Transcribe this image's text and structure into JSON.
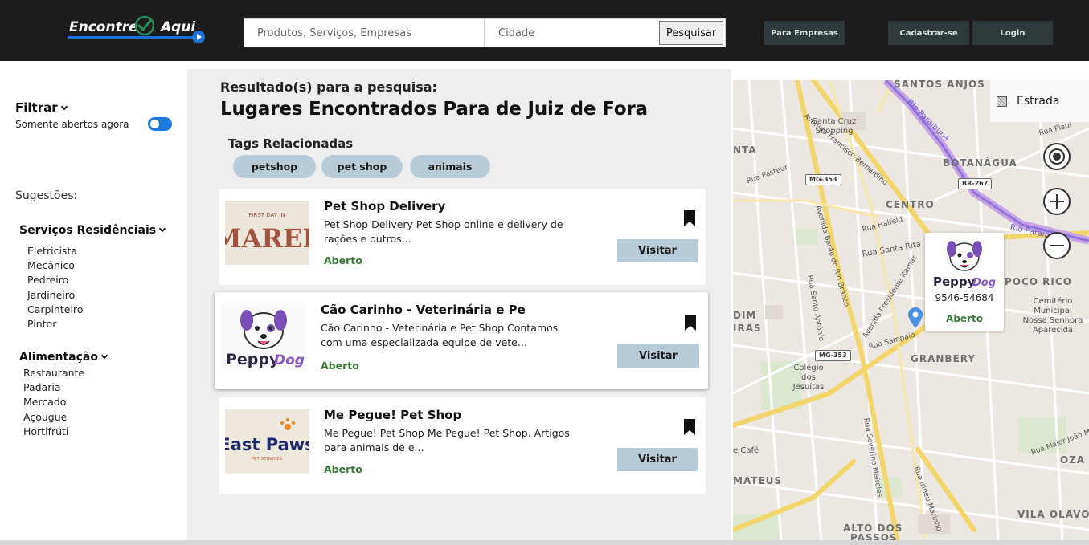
{
  "header": {
    "logo_part1": "Encontre",
    "logo_part2": "Aqui",
    "search_placeholder": "Produtos, Serviços, Empresas",
    "city_placeholder": "Cidade",
    "search_button": "Pesquisar",
    "for_business": "Para Empresas",
    "signup": "Cadastrar-se",
    "login": "Login"
  },
  "sidebar": {
    "filter_title": "Filtrar",
    "open_now_label": "Somente abertos agora",
    "open_now_enabled": true,
    "suggestions_title": "Sugestões:",
    "categories": [
      {
        "title": "Serviços Residênciais",
        "items": [
          "Eletricista",
          "Mecânico",
          "Pedreiro",
          "Jardineiro",
          "Carpinteiro",
          "Pintor"
        ]
      },
      {
        "title": "Alimentação",
        "items": [
          "Restaurante",
          "Padaria",
          "Mercado",
          "Açougue",
          "Hortifrúti"
        ]
      }
    ]
  },
  "results": {
    "subtitle": "Resultado(s) para a pesquisa:",
    "title": "Lugares Encontrados Para de Juiz de Fora",
    "tags_title": "Tags Relacionadas",
    "tags": [
      "petshop",
      "pet shop",
      "animais"
    ],
    "visit_label": "Visitar",
    "cards": [
      {
        "name": "Pet Shop Delivery",
        "description": "Pet Shop Delivery Pet Shop online e delivery de rações e outros...",
        "status": "Aberto",
        "logo_text_small": "FIRST DAY IN",
        "logo_text_big": "MAREL"
      },
      {
        "name": "Cão Carinho - Veterinária e Pe",
        "description": "Cão Carinho - Veterinária e Pet Shop Contamos com uma especializada equipe de vete...",
        "status": "Aberto",
        "logo_text_big": "Peppy",
        "logo_text_accent": "Dog"
      },
      {
        "name": "Me Pegue! Pet Shop",
        "description": "Me Pegue! Pet Shop Me Pegue! Pet Shop. Artigos para animais de e...",
        "status": "Aberto",
        "logo_text_big": "East Paws",
        "logo_text_small": "PET SERVICES"
      }
    ]
  },
  "map": {
    "layer_label": "Estrada",
    "popup": {
      "logo_text": "Peppy",
      "logo_accent": "Dog",
      "phone": "9546-54684",
      "status": "Aberto"
    },
    "labels": {
      "santos_anjos": "SANTOS ANJOS",
      "av_francisco": "Avenida Francisco Bernardino",
      "rio_paraibuna": "Rio Paraibuna",
      "santa_cruz": "Santa Cruz Shopping",
      "ta": "NTA",
      "rua_pasteur": "Rua Pasteur",
      "mg353_a": "MG-353",
      "botanagua": "BOTANÁGUA",
      "br267": "BR-267",
      "rua_piaui": "Rua Piauí",
      "centro": "CENTRO",
      "av_barao": "Avenida Barão do Rio Branco",
      "rua_halfeld": "Rua Halfeld",
      "rua_santa_rita": "Rua Santa Rita",
      "rio_paraib2": "Rio Paraib",
      "av_itamar": "Avenida Presidente Itamar",
      "poco_rico": "POÇO RICO",
      "rua_santo_antonio": "Rua Santo Antônio",
      "dim": "DIM",
      "iras": "IRAS",
      "cemiterio": "Cemitério Municipal Nossa Senhora Aparecida",
      "rua_sampaio": "Rua Sampaio",
      "mg353_b": "MG-353",
      "granbery": "GRANBERY",
      "colegio": "Colégio dos Jesuítas",
      "rua_severino": "Rua Severino Meireles",
      "cafe": "e Café",
      "rua_irineu": "Rua Irineu Marinho",
      "mateus": "MATEUS",
      "rua_major": "Rua Major João M",
      "oza": "OZA",
      "vila_olavo": "VILA OLAVO",
      "alto_dos": "ALTO DOS",
      "passos": "PASSOS"
    }
  },
  "colors": {
    "header_bg": "#1c1c1c",
    "accent_blue": "#1f7ae0",
    "tag_bg": "#b8cbd8",
    "status_green": "#3c7a3c",
    "panel_bg": "#eeeeee"
  }
}
